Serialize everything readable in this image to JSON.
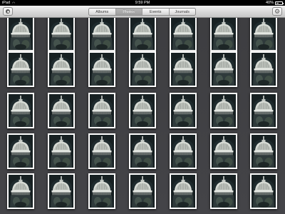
{
  "status_bar": {
    "carrier": "iPad",
    "time": "9:59 PM",
    "battery_percent": "40%",
    "battery_level": 0.4
  },
  "toolbar": {
    "menu_icon": "menu-circle-icon",
    "settings_icon": "gear-icon",
    "tabs": [
      {
        "label": "Albums",
        "active": false
      },
      {
        "label": "Photos",
        "active": true
      },
      {
        "label": "Events",
        "active": false
      },
      {
        "label": "Journals",
        "active": false
      }
    ]
  },
  "grid": {
    "columns": 7,
    "rows": 5,
    "thumbnail_subject": "domed-tower-night-photo"
  },
  "colors": {
    "background": "#404044",
    "toolbar": "#d6d6d6",
    "active_tab": "#a8a8a8"
  }
}
